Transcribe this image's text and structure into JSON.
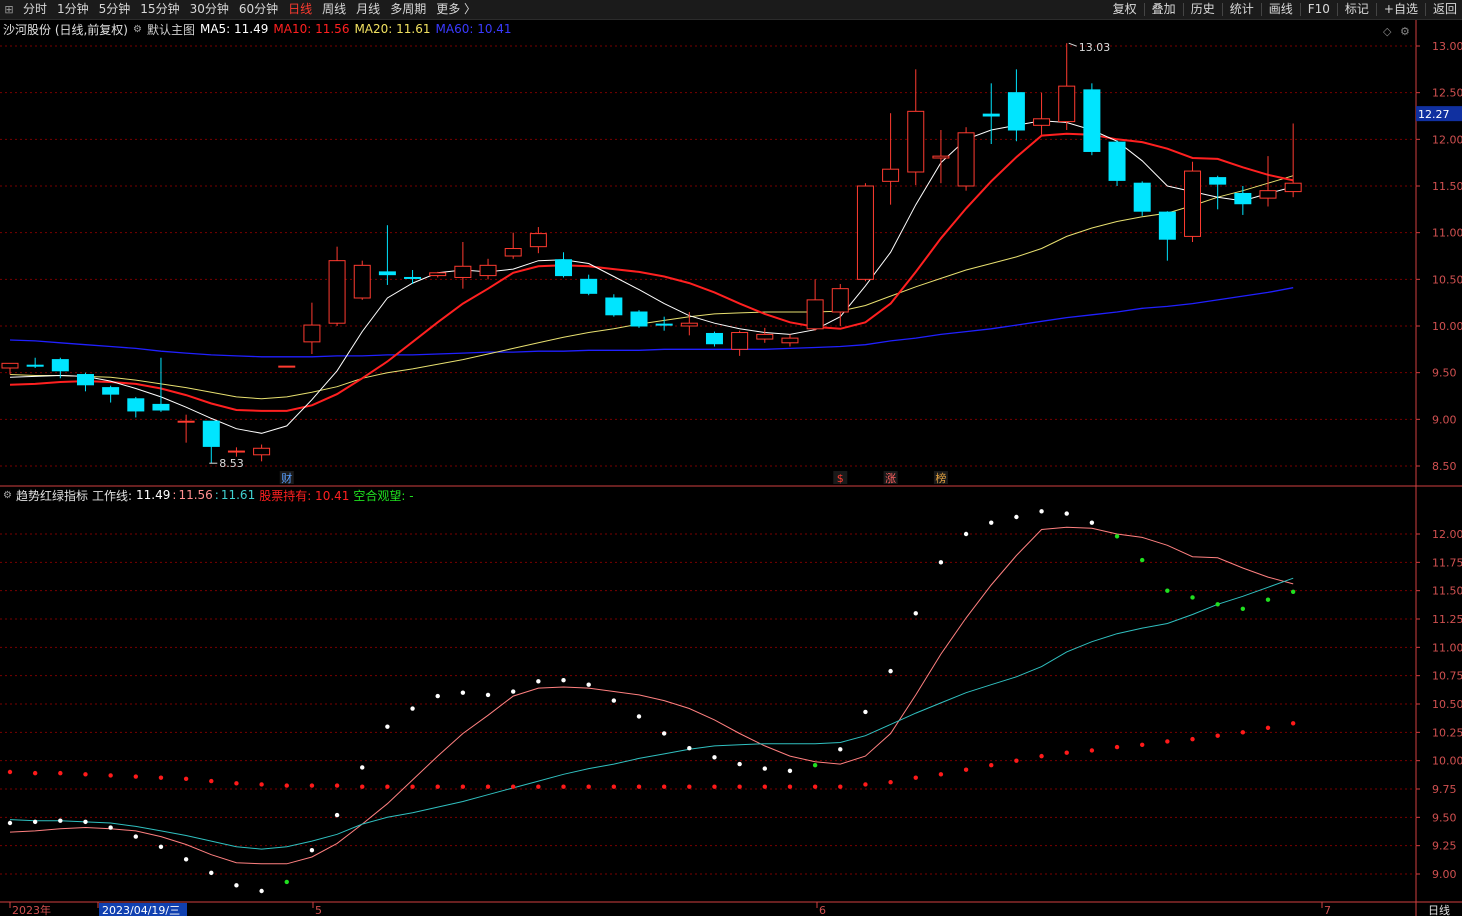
{
  "toolbar": {
    "left_items": [
      "分时",
      "1分钟",
      "5分钟",
      "15分钟",
      "30分钟",
      "60分钟",
      "日线",
      "周线",
      "月线",
      "多周期",
      "更多 〉"
    ],
    "active": "日线",
    "right_items": [
      "复权",
      "叠加",
      "历史",
      "统计",
      "画线",
      "F10",
      "标记",
      "+自选",
      "返回"
    ]
  },
  "header": {
    "stock": "沙河股份 (日线,前复权)",
    "view": "默认主图",
    "ma5": "MA5: 11.49",
    "ma10": "MA10: 11.56",
    "ma20": "MA20: 11.61",
    "ma60": "MA60: 10.41"
  },
  "indicator": {
    "name": "趋势红绿指标",
    "workline_label": "工作线:",
    "v1": "11.49",
    "v2": "11.56",
    "v3": "11.61",
    "hold": "股票持有: 10.41",
    "watch": "空合观望: -"
  },
  "colors": {
    "up": "#ff3b30",
    "down": "#00e5ff",
    "ma5": "#ffffff",
    "ma10": "#ff2020",
    "ma20": "#e8e070",
    "ma60": "#2020ff",
    "grid": "#7a0000",
    "axis": "#d04040"
  },
  "main_axis": {
    "ticks": [
      "13.00",
      "12.50",
      "12.00",
      "11.50",
      "11.00",
      "10.50",
      "10.00",
      "9.50",
      "9.00",
      "8.50"
    ],
    "current": "12.27",
    "high_label": "13.03",
    "low_label": "8.53"
  },
  "sub_axis": {
    "ticks": [
      "12.00",
      "11.75",
      "11.50",
      "11.25",
      "11.00",
      "10.75",
      "10.50",
      "10.25",
      "10.00",
      "9.75",
      "9.50",
      "9.25",
      "9.00"
    ]
  },
  "event_markers": [
    "财",
    "$",
    "涨",
    "榜"
  ],
  "x_axis": {
    "labels": [
      "2023年",
      "2023/04/19/三",
      "5",
      "6",
      "7"
    ],
    "period": "日线"
  },
  "chart_data": {
    "type": "candlestick",
    "candles": [
      [
        9.55,
        9.6,
        9.6,
        9.48
      ],
      [
        9.58,
        9.57,
        9.66,
        9.55
      ],
      [
        9.64,
        9.52,
        9.66,
        9.44
      ],
      [
        9.48,
        9.37,
        9.5,
        9.3
      ],
      [
        9.34,
        9.27,
        9.36,
        9.18
      ],
      [
        9.22,
        9.09,
        9.24,
        9.02
      ],
      [
        9.16,
        9.1,
        9.66,
        9.08
      ],
      [
        8.98,
        8.98,
        9.05,
        8.75
      ],
      [
        8.98,
        8.71,
        8.98,
        8.53
      ],
      [
        8.65,
        8.66,
        8.7,
        8.6
      ],
      [
        8.62,
        8.69,
        8.73,
        8.55
      ],
      [
        9.57,
        9.57,
        9.57,
        9.57
      ],
      [
        9.83,
        10.01,
        10.25,
        9.7
      ],
      [
        10.03,
        10.7,
        10.85,
        10.0
      ],
      [
        10.3,
        10.65,
        10.7,
        10.28
      ],
      [
        10.58,
        10.55,
        11.08,
        10.44
      ],
      [
        10.52,
        10.51,
        10.6,
        10.45
      ],
      [
        10.54,
        10.57,
        10.58,
        10.52
      ],
      [
        10.52,
        10.64,
        10.9,
        10.4
      ],
      [
        10.54,
        10.65,
        10.72,
        10.5
      ],
      [
        10.75,
        10.83,
        11.0,
        10.72
      ],
      [
        10.85,
        10.99,
        11.06,
        10.78
      ],
      [
        10.71,
        10.54,
        10.79,
        10.52
      ],
      [
        10.5,
        10.35,
        10.55,
        10.33
      ],
      [
        10.3,
        10.12,
        10.34,
        10.1
      ],
      [
        10.15,
        10.0,
        10.17,
        9.98
      ],
      [
        10.02,
        10.01,
        10.1,
        9.95
      ],
      [
        10.0,
        10.03,
        10.15,
        9.9
      ],
      [
        9.92,
        9.81,
        9.94,
        9.78
      ],
      [
        9.75,
        9.93,
        9.95,
        9.68
      ],
      [
        9.86,
        9.91,
        9.98,
        9.82
      ],
      [
        9.82,
        9.87,
        9.91,
        9.78
      ],
      [
        9.97,
        10.28,
        10.5,
        9.95
      ],
      [
        10.15,
        10.4,
        10.45,
        10.0
      ],
      [
        10.5,
        11.5,
        11.53,
        10.48
      ],
      [
        11.55,
        11.68,
        12.28,
        11.3
      ],
      [
        11.65,
        12.3,
        12.75,
        11.51
      ],
      [
        11.8,
        11.82,
        12.1,
        11.53
      ],
      [
        11.5,
        12.07,
        12.13,
        11.45
      ],
      [
        12.27,
        12.25,
        12.6,
        11.95
      ],
      [
        12.5,
        12.1,
        12.75,
        11.98
      ],
      [
        12.15,
        12.22,
        12.5,
        12.05
      ],
      [
        12.19,
        12.57,
        13.03,
        12.1
      ],
      [
        12.53,
        11.87,
        12.6,
        11.83
      ],
      [
        11.97,
        11.56,
        11.99,
        11.5
      ],
      [
        11.53,
        11.23,
        11.55,
        11.18
      ],
      [
        11.22,
        10.93,
        11.23,
        10.7
      ],
      [
        10.96,
        11.66,
        11.76,
        10.9
      ],
      [
        11.59,
        11.52,
        11.61,
        11.25
      ],
      [
        11.42,
        11.31,
        11.5,
        11.19
      ],
      [
        11.37,
        11.45,
        11.82,
        11.28
      ],
      [
        11.44,
        11.53,
        12.17,
        11.38
      ]
    ],
    "ma5": [
      9.45,
      9.46,
      9.47,
      9.46,
      9.41,
      9.33,
      9.24,
      9.13,
      9.01,
      8.9,
      8.85,
      8.93,
      9.21,
      9.52,
      9.94,
      10.3,
      10.46,
      10.57,
      10.6,
      10.58,
      10.61,
      10.7,
      10.71,
      10.67,
      10.53,
      10.39,
      10.24,
      10.11,
      10.03,
      9.97,
      9.93,
      9.91,
      9.96,
      10.1,
      10.43,
      10.79,
      11.3,
      11.75,
      12.0,
      12.1,
      12.15,
      12.2,
      12.18,
      12.1,
      11.98,
      11.77,
      11.5,
      11.44,
      11.38,
      11.34,
      11.42,
      11.49
    ],
    "ma10": [
      9.37,
      9.38,
      9.4,
      9.41,
      9.4,
      9.38,
      9.33,
      9.26,
      9.17,
      9.1,
      9.09,
      9.09,
      9.15,
      9.27,
      9.44,
      9.62,
      9.83,
      10.04,
      10.24,
      10.4,
      10.57,
      10.64,
      10.65,
      10.64,
      10.61,
      10.58,
      10.53,
      10.46,
      10.36,
      10.24,
      10.13,
      10.04,
      9.99,
      9.97,
      10.04,
      10.24,
      10.58,
      10.94,
      11.26,
      11.55,
      11.81,
      12.04,
      12.06,
      12.05,
      12.0,
      11.97,
      11.9,
      11.8,
      11.79,
      11.7,
      11.62,
      11.56
    ],
    "ma20": [
      9.48,
      9.47,
      9.47,
      9.46,
      9.45,
      9.42,
      9.38,
      9.34,
      9.29,
      9.24,
      9.22,
      9.24,
      9.29,
      9.35,
      9.44,
      9.5,
      9.54,
      9.59,
      9.64,
      9.7,
      9.76,
      9.82,
      9.88,
      9.93,
      9.97,
      10.02,
      10.06,
      10.1,
      10.13,
      10.14,
      10.15,
      10.15,
      10.15,
      10.16,
      10.22,
      10.32,
      10.42,
      10.51,
      10.6,
      10.67,
      10.74,
      10.83,
      10.96,
      11.05,
      11.12,
      11.17,
      11.21,
      11.29,
      11.38,
      11.45,
      11.53,
      11.61
    ],
    "ma60": [
      9.85,
      9.84,
      9.82,
      9.8,
      9.78,
      9.76,
      9.73,
      9.71,
      9.69,
      9.68,
      9.67,
      9.67,
      9.67,
      9.68,
      9.68,
      9.69,
      9.69,
      9.7,
      9.71,
      9.72,
      9.72,
      9.73,
      9.73,
      9.74,
      9.74,
      9.74,
      9.75,
      9.75,
      9.75,
      9.75,
      9.75,
      9.76,
      9.77,
      9.78,
      9.8,
      9.84,
      9.87,
      9.91,
      9.94,
      9.97,
      10.01,
      10.05,
      10.09,
      10.12,
      10.15,
      10.19,
      10.21,
      10.24,
      10.28,
      10.32,
      10.36,
      10.41
    ],
    "hold_dots": [
      9.9,
      9.89,
      9.89,
      9.88,
      9.87,
      9.86,
      9.85,
      9.84,
      9.82,
      9.8,
      9.79,
      9.78,
      9.78,
      9.78,
      9.77,
      9.77,
      9.77,
      9.77,
      9.77,
      9.77,
      9.77,
      9.77,
      9.77,
      9.77,
      9.77,
      9.77,
      9.77,
      9.77,
      9.77,
      9.77,
      9.77,
      9.77,
      9.77,
      9.77,
      9.79,
      9.81,
      9.85,
      9.88,
      9.92,
      9.96,
      10.0,
      10.04,
      10.07,
      10.09,
      10.12,
      10.14,
      10.17,
      10.19,
      10.22,
      10.25,
      10.29,
      10.33
    ]
  }
}
